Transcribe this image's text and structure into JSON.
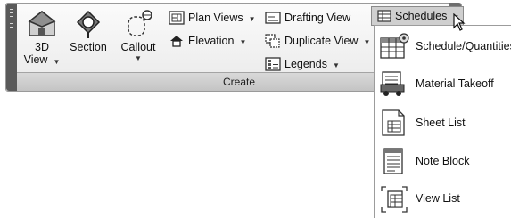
{
  "panel": {
    "title": "Create"
  },
  "buttons": {
    "view_3d_line1": "3D",
    "view_3d_line2": "View",
    "section": "Section",
    "callout": "Callout",
    "plan_views": "Plan Views",
    "elevation": "Elevation",
    "drafting_view": "Drafting View",
    "duplicate_view": "Duplicate View",
    "legends": "Legends",
    "schedules": "Schedules"
  },
  "menu": {
    "items": [
      {
        "label": "Schedule/Quantities",
        "icon": "schedule-quantities-icon"
      },
      {
        "label": "Material Takeoff",
        "icon": "material-takeoff-icon"
      },
      {
        "label": "Sheet List",
        "icon": "sheet-list-icon"
      },
      {
        "label": "Note Block",
        "icon": "note-block-icon"
      },
      {
        "label": "View List",
        "icon": "view-list-icon"
      }
    ]
  },
  "colors": {
    "panel_bg": "#f2f2f2",
    "panel_footer": "#cccccc",
    "grip": "#5a5a5a",
    "pressed": "#cfcfcf"
  }
}
